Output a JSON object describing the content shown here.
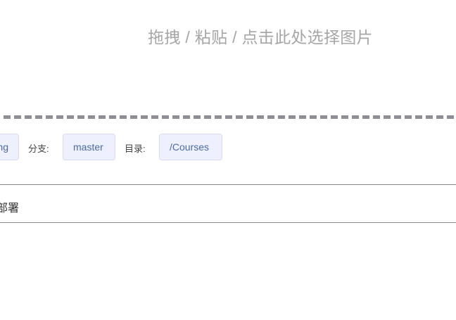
{
  "upload": {
    "icon": "upload-cloud-icon",
    "hint": "拖拽 / 粘贴 / 点击此处选择图片"
  },
  "repo_info": {
    "repo_value": "ng",
    "branch_label": "分支:",
    "branch_value": "master",
    "dir_label": "目录:",
    "dir_value": "/Courses"
  },
  "deploy": {
    "label": "部署"
  },
  "colors": {
    "hint_gray": "#a6a6a6",
    "chip_bg": "#eef1fd",
    "chip_text": "#4a6aa8",
    "dashed": "#8e8e96"
  }
}
